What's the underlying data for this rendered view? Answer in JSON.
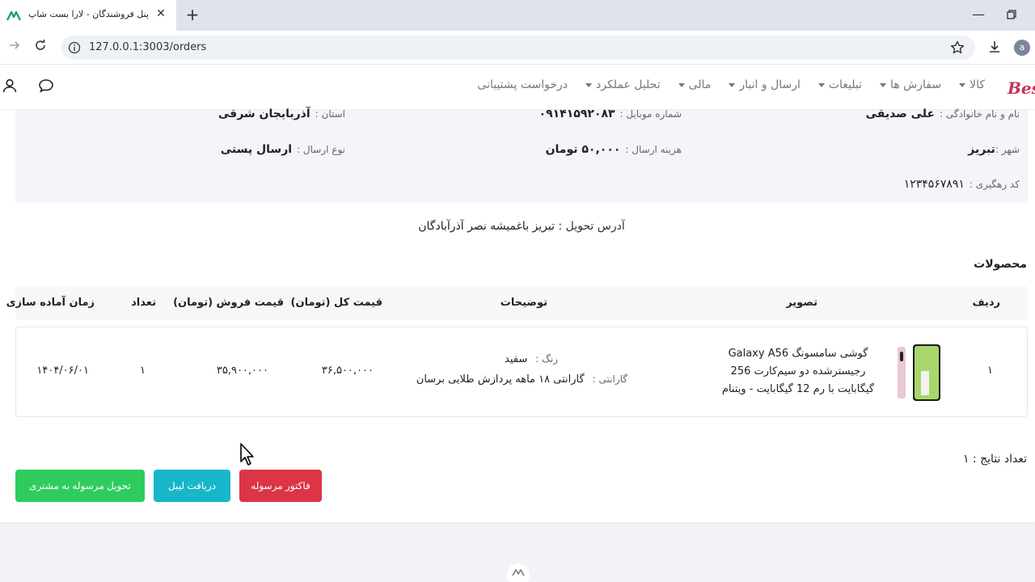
{
  "browser": {
    "tab_title": "پنل فروشندگان - لارا بست شاپ",
    "tab_close": "✕",
    "new_tab": "+",
    "url": "127.0.0.1:3003/orders",
    "profile_initial": "a",
    "minimize": "—"
  },
  "header": {
    "logo_text": "BestS",
    "nav": [
      {
        "label": "کالا",
        "has_caret": true
      },
      {
        "label": "سفارش ها",
        "has_caret": true
      },
      {
        "label": "تبلیغات",
        "has_caret": true
      },
      {
        "label": "ارسال و انبار",
        "has_caret": true
      },
      {
        "label": "مالی",
        "has_caret": true
      },
      {
        "label": "تحلیل عملکرد",
        "has_caret": true
      },
      {
        "label": "درخواست پشتیبانی",
        "has_caret": false
      }
    ]
  },
  "order_info": {
    "fullname_label": "نام و نام خانوادگی :",
    "fullname": "علی صدیقی",
    "mobile_label": "شماره موبایل :",
    "mobile": "۰۹۱۴۱۵۹۲۰۸۳",
    "province_label": "استان :",
    "province": "آذربایجان شرقی",
    "city_label": "شهر :",
    "city": "تبریز",
    "shipping_cost_label": "هزینه ارسال :",
    "shipping_cost": "۵۰,۰۰۰ تومان",
    "shipping_type_label": "نوع ارسال :",
    "shipping_type": "ارسال پستی",
    "tracking_label": "کد رهگیری :",
    "tracking": "۱۲۳۴۵۶۷۸۹۱",
    "address_label": "آدرس تحویل :",
    "address": "تبریز باغمیشه نصر آذرآبادگان"
  },
  "products": {
    "title": "محصولات",
    "columns": {
      "row": "ردیف",
      "image": "تصویر",
      "description": "توضیحات",
      "total_price": "قیمت کل (تومان)",
      "sale_price": "قیمت فروش (تومان)",
      "quantity": "تعداد",
      "prep_time": "زمان آماده سازی"
    },
    "rows": [
      {
        "row": "۱",
        "name": "گوشی سامسونگ Galaxy A56 رجیسترشده دو سیم‌کارت 256 گیگابایت با رم 12 گیگابایت - ویتنام",
        "color_label": "رنگ :",
        "color": "سفید",
        "warranty_label": "گارانتی :",
        "warranty": "گارانتی ۱۸ ماهه پردازش طلایی برسان",
        "total_price": "۳۶,۵۰۰,۰۰۰",
        "sale_price": "۳۵,۹۰۰,۰۰۰",
        "quantity": "۱",
        "prep_time": "۱۴۰۴/۰۶/۰۱"
      }
    ]
  },
  "results": {
    "label": "تعداد نتایج : ۱"
  },
  "actions": {
    "invoice": "فاکتور مرسوله",
    "label": "دریافت لیبل",
    "deliver": "تحویل مرسوله به مشتری"
  },
  "colors": {
    "danger": "#dc3545",
    "info": "#17b6c9",
    "success": "#2ecc5e"
  }
}
